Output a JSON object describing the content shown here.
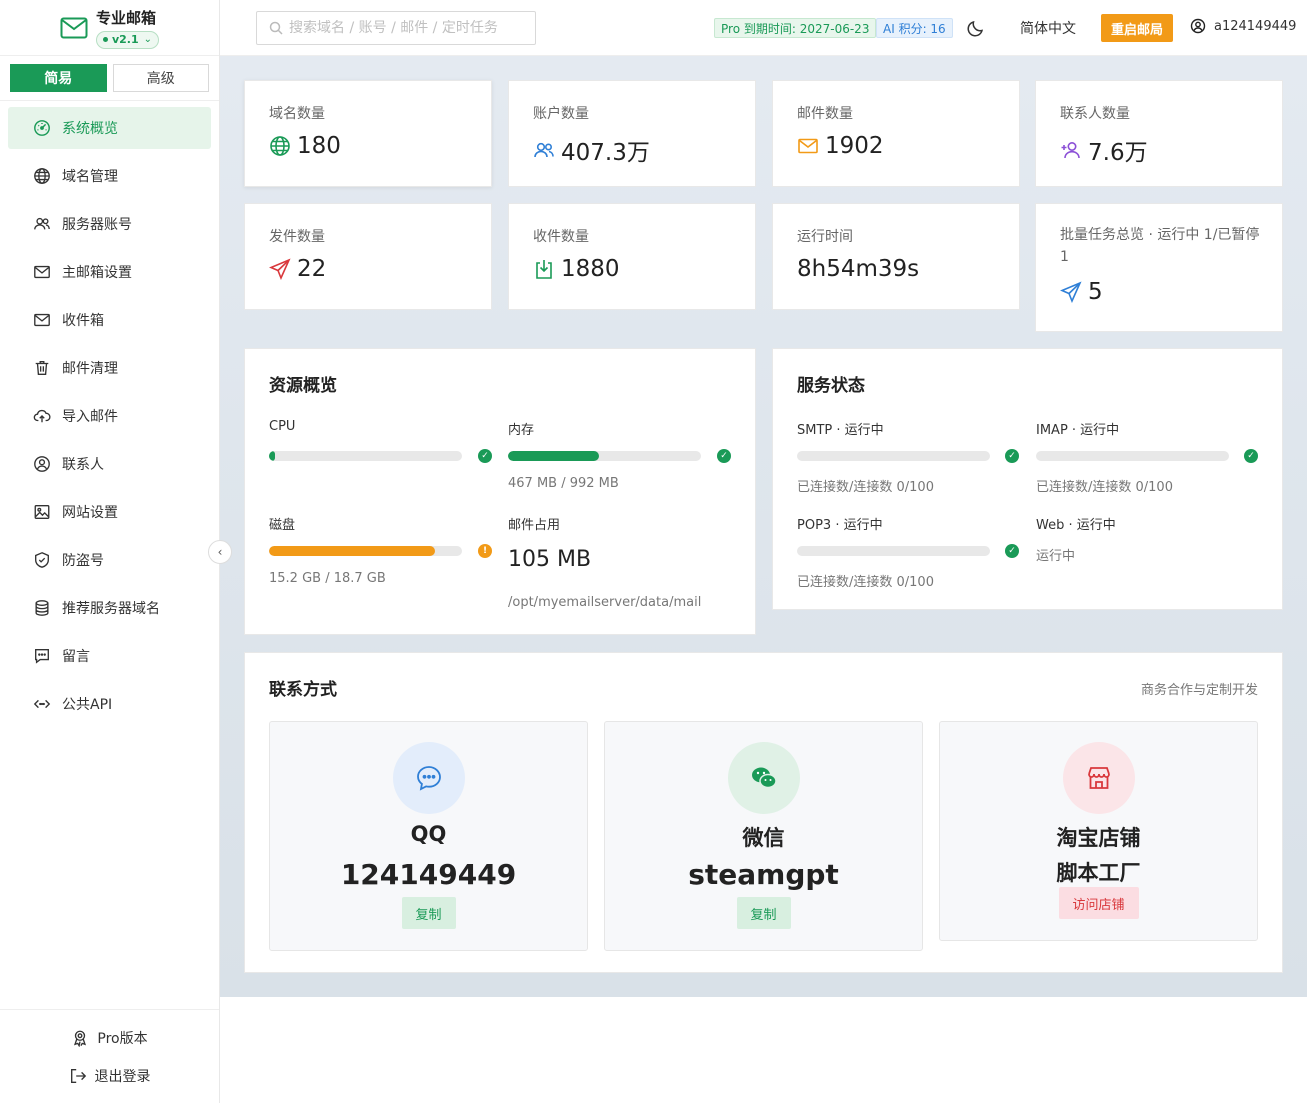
{
  "brand": {
    "title": "专业邮箱",
    "version": "v2.1"
  },
  "mode": {
    "simple": "简易",
    "advanced": "高级"
  },
  "nav": [
    {
      "label": "系统概览",
      "icon": "dashboard-icon"
    },
    {
      "label": "域名管理",
      "icon": "globe-icon"
    },
    {
      "label": "服务器账号",
      "icon": "users-icon"
    },
    {
      "label": "主邮箱设置",
      "icon": "mail-icon"
    },
    {
      "label": "收件箱",
      "icon": "inbox-icon"
    },
    {
      "label": "邮件清理",
      "icon": "trash-icon"
    },
    {
      "label": "导入邮件",
      "icon": "cloud-upload-icon"
    },
    {
      "label": "联系人",
      "icon": "user-circle-icon"
    },
    {
      "label": "网站设置",
      "icon": "image-icon"
    },
    {
      "label": "防盗号",
      "icon": "shield-icon"
    },
    {
      "label": "推荐服务器域名",
      "icon": "database-icon"
    },
    {
      "label": "留言",
      "icon": "message-icon"
    },
    {
      "label": "公共API",
      "icon": "code-icon"
    }
  ],
  "footer": {
    "pro": "Pro版本",
    "logout": "退出登录"
  },
  "header": {
    "search_placeholder": "搜索域名 / 账号 / 邮件 / 定时任务",
    "pro_expire": "Pro 到期时间: 2027-06-23",
    "ai_points": "AI 积分: 16",
    "language": "简体中文",
    "restart": "重启邮局",
    "username": "a124149449"
  },
  "stats": {
    "domains": {
      "label": "域名数量",
      "value": "180"
    },
    "accounts": {
      "label": "账户数量",
      "value": "407.3万"
    },
    "mails": {
      "label": "邮件数量",
      "value": "1902"
    },
    "contacts": {
      "label": "联系人数量",
      "value": "7.6万"
    },
    "sent": {
      "label": "发件数量",
      "value": "22"
    },
    "received": {
      "label": "收件数量",
      "value": "1880"
    },
    "uptime": {
      "label": "运行时间",
      "value": "8h54m39s"
    },
    "batch": {
      "label": "批量任务总览 · 运行中 1/已暂停 1",
      "value": "5"
    }
  },
  "resources": {
    "title": "资源概览",
    "cpu": {
      "label": "CPU",
      "fraction": 0.03
    },
    "memory": {
      "label": "内存",
      "detail": "467 MB / 992 MB",
      "fraction": 0.47
    },
    "disk": {
      "label": "磁盘",
      "detail": "15.2 GB / 18.7 GB",
      "fraction": 0.86
    },
    "mail_usage": {
      "label": "邮件占用",
      "value": "105 MB",
      "path": "/opt/myemailserver/data/mail"
    },
    "colors": {
      "ok": "#1a9a57",
      "warn": "#f29a17"
    }
  },
  "services": {
    "title": "服务状态",
    "smtp": {
      "label": "SMTP · 运行中",
      "detail": "已连接数/连接数 0/100"
    },
    "imap": {
      "label": "IMAP · 运行中",
      "detail": "已连接数/连接数 0/100"
    },
    "pop3": {
      "label": "POP3 · 运行中",
      "detail": "已连接数/连接数 0/100"
    },
    "web": {
      "label": "Web · 运行中",
      "detail": "运行中"
    }
  },
  "contact": {
    "title": "联系方式",
    "subtitle": "商务合作与定制开发",
    "qq": {
      "name": "QQ",
      "value": "124149449",
      "button": "复制"
    },
    "wechat": {
      "name": "微信",
      "value": "steamgpt",
      "button": "复制"
    },
    "taobao": {
      "name": "淘宝店铺",
      "value": "脚本工厂",
      "button": "访问店铺"
    }
  }
}
